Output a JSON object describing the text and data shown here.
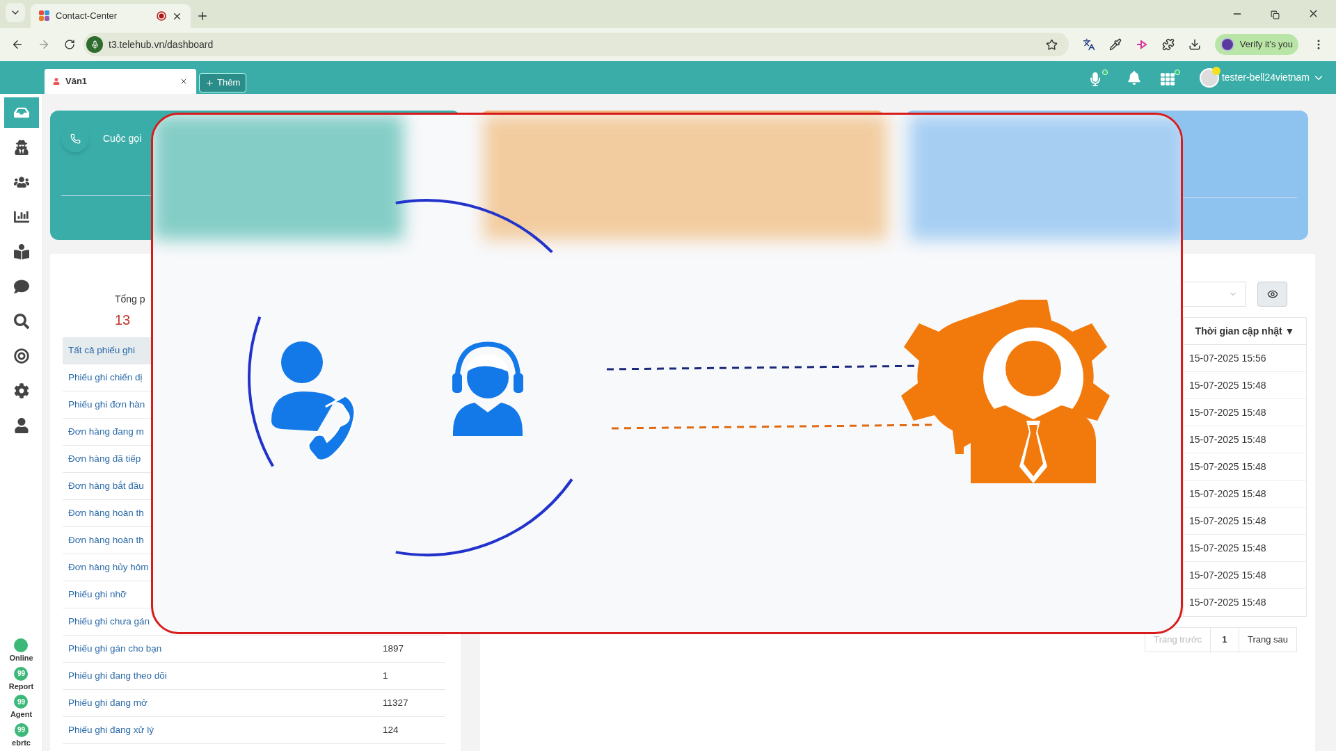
{
  "browser": {
    "tab_title": "Contact-Center",
    "url": "t3.telehub.vn/dashboard",
    "verify_button": "Verify it's you"
  },
  "app_header": {
    "tabs": [
      {
        "label": "Văn1",
        "selected": true
      }
    ],
    "add_tab": "Thêm",
    "user": "tester-bell24vietnam"
  },
  "sidebar": {
    "items": [
      {
        "selected": true
      },
      {
        "selected": false
      },
      {
        "selected": false
      },
      {
        "selected": false
      },
      {
        "selected": false
      },
      {
        "selected": false
      },
      {
        "selected": false
      },
      {
        "selected": false
      },
      {
        "selected": false
      },
      {
        "selected": false
      }
    ],
    "status": [
      {
        "kind": "dot",
        "label": "Online"
      },
      {
        "kind": "badge",
        "badge": "99",
        "label": "Report"
      },
      {
        "kind": "badge",
        "badge": "99",
        "label": "Agent"
      },
      {
        "kind": "badge",
        "badge": "99",
        "label": "ebrtc"
      }
    ]
  },
  "call_card": {
    "title": "Cuộc gọi"
  },
  "summary": {
    "label": "Tổng p",
    "value": "13"
  },
  "ticket_list": [
    {
      "label": "Tất cả phiếu ghi",
      "selected": true
    },
    {
      "label": "Phiếu ghi chiến dị",
      "selected": false
    },
    {
      "label": "Phiếu ghi đơn hàn",
      "selected": false
    },
    {
      "label": "Đơn hàng đang m",
      "selected": false
    },
    {
      "label": "Đơn hàng đã tiếp",
      "selected": false
    },
    {
      "label": "Đơn hàng bắt đầu",
      "selected": false
    },
    {
      "label": "Đơn hàng hoàn th",
      "selected": false
    },
    {
      "label": "Đơn hàng hoàn th",
      "selected": false
    },
    {
      "label": "Đơn hàng hủy hôm",
      "selected": false
    },
    {
      "label": "Phiếu ghi nhỡ",
      "selected": false
    },
    {
      "label": "Phiếu ghi chưa gán",
      "selected": false
    },
    {
      "label": "Phiếu ghi gán cho bạn",
      "count": "1897",
      "selected": false
    },
    {
      "label": "Phiếu ghi đang theo dõi",
      "count": "1",
      "selected": false
    },
    {
      "label": "Phiếu ghi đang mở",
      "count": "11327",
      "selected": false
    },
    {
      "label": "Phiếu ghi đang xử lý",
      "count": "124",
      "selected": false
    }
  ],
  "table": {
    "column": "Thời gian cập nhật",
    "sort_mark": "▼",
    "rows": [
      "15-07-2025 15:56",
      "15-07-2025 15:48",
      "15-07-2025 15:48",
      "15-07-2025 15:48",
      "15-07-2025 15:48",
      "15-07-2025 15:48",
      "15-07-2025 15:48",
      "15-07-2025 15:48",
      "15-07-2025 15:48",
      "15-07-2025 15:48"
    ]
  },
  "pagination": {
    "previous": "Trang trước",
    "previous_disabled": true,
    "page": "1",
    "next": "Trang sau"
  }
}
